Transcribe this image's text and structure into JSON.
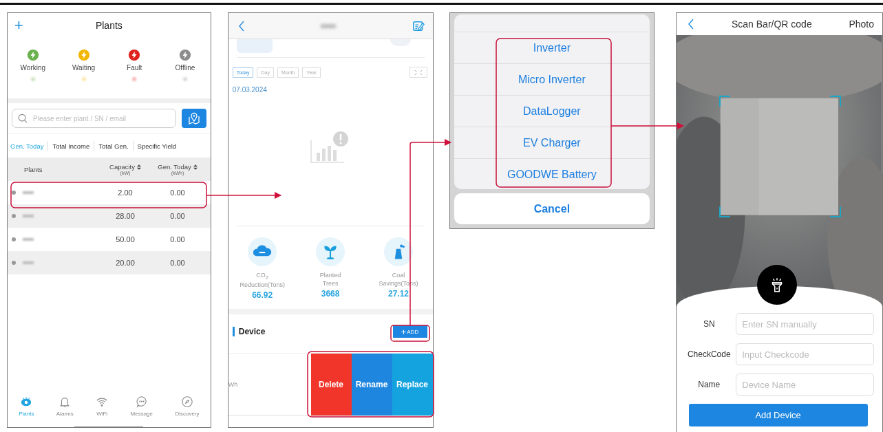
{
  "plants_screen": {
    "add_icon": "+",
    "title": "Plants",
    "status_summary": [
      {
        "label": "Working",
        "color": "#6ab04c"
      },
      {
        "label": "Waiting",
        "color": "#f2b705"
      },
      {
        "label": "Fault",
        "color": "#e0221e"
      },
      {
        "label": "Offline",
        "color": "#8c8c8c"
      }
    ],
    "search": {
      "placeholder": "Please enter plant / SN / email"
    },
    "tabs": [
      {
        "label": "Gen. Today",
        "selected": true
      },
      {
        "label": "Total Income",
        "selected": false
      },
      {
        "label": "Total Gen.",
        "selected": false
      },
      {
        "label": "Specific Yield",
        "selected": false
      }
    ],
    "table": {
      "columns": [
        {
          "label": "Plants"
        },
        {
          "label": "Capacity",
          "unit": "(kW)",
          "sortable": true
        },
        {
          "label": "Gen. Today",
          "unit": "(kWh)",
          "sortable": true
        }
      ],
      "rows": [
        {
          "capacity": "2.00",
          "gen_today": "0.00"
        },
        {
          "capacity": "28.00",
          "gen_today": "0.00"
        },
        {
          "capacity": "50.00",
          "gen_today": "0.00"
        },
        {
          "capacity": "20.00",
          "gen_today": "0.00"
        }
      ]
    },
    "nav": [
      {
        "kind": "plants",
        "label": "Plants",
        "selected": true
      },
      {
        "kind": "alarms",
        "label": "Alarms",
        "selected": false
      },
      {
        "kind": "wifi",
        "label": "WiFi",
        "selected": false
      },
      {
        "kind": "message",
        "label": "Message",
        "selected": false
      },
      {
        "kind": "discovery",
        "label": "Discovery",
        "selected": false
      }
    ]
  },
  "detail_screen": {
    "period_tabs": [
      {
        "label": "Today",
        "selected": true
      },
      {
        "label": "Day",
        "selected": false
      },
      {
        "label": "Month",
        "selected": false
      },
      {
        "label": "Year",
        "selected": false
      }
    ],
    "date": "07.03.2024",
    "stats": [
      {
        "kind": "co2",
        "title": "CO$_{2}$",
        "subtitle": "Reduction(Tons)",
        "value": "66.92"
      },
      {
        "kind": "tree",
        "title": "Planted",
        "subtitle": "Trees",
        "value": "3668"
      },
      {
        "kind": "coal",
        "title": "Coal",
        "subtitle": "Savings(Tons)",
        "value": "27.12"
      }
    ],
    "device_section": {
      "title": "Device",
      "add_icon": "+",
      "add_label": "ADD"
    },
    "device_row": {
      "reading": "Wh"
    },
    "swipe_actions": [
      {
        "label": "Delete",
        "color": "#f2352b"
      },
      {
        "label": "Rename",
        "color": "#1f86e0"
      },
      {
        "label": "Replace",
        "color": "#15a3e0"
      }
    ]
  },
  "device_type_sheet": {
    "options": [
      "Inverter",
      "Micro Inverter",
      "DataLogger",
      "EV Charger",
      "GOODWE Battery"
    ],
    "cancel": "Cancel"
  },
  "scan_screen": {
    "title": "Scan Bar/QR code",
    "photo": "Photo",
    "fields": [
      {
        "label": "SN",
        "placeholder": "Enter SN manually"
      },
      {
        "label": "CheckCode",
        "placeholder": "Input Checkcode"
      },
      {
        "label": "Name",
        "placeholder": "Device Name"
      }
    ],
    "submit": "Add Device"
  }
}
